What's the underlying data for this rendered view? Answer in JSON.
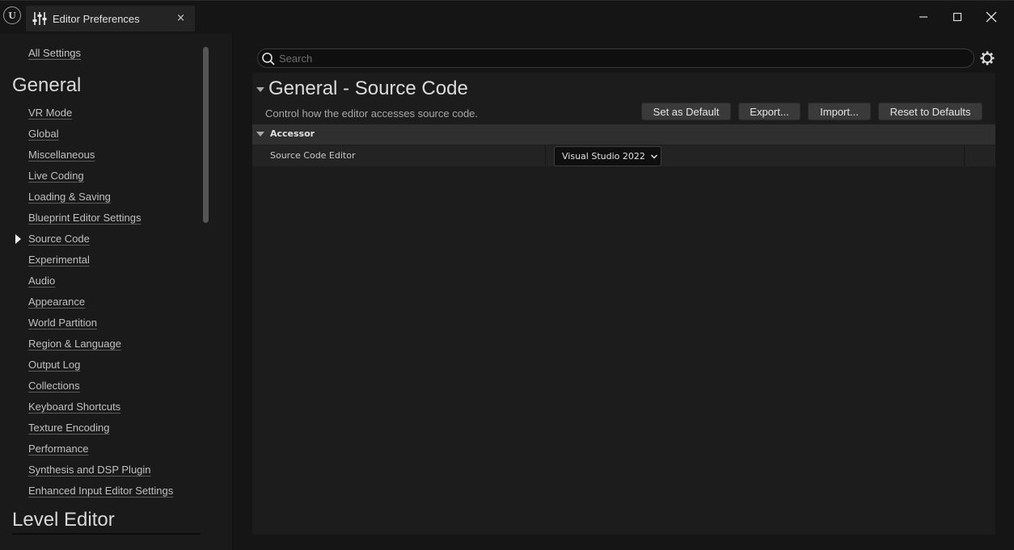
{
  "window": {
    "tab_title": "Editor Preferences",
    "tab_close": "×"
  },
  "sidebar": {
    "all_settings": "All Settings",
    "general_title": "General",
    "items": [
      {
        "label": "VR Mode"
      },
      {
        "label": "Global"
      },
      {
        "label": "Miscellaneous"
      },
      {
        "label": "Live Coding"
      },
      {
        "label": "Loading & Saving"
      },
      {
        "label": "Blueprint Editor Settings"
      },
      {
        "label": "Source Code",
        "selected": true
      },
      {
        "label": "Experimental"
      },
      {
        "label": "Audio"
      },
      {
        "label": "Appearance"
      },
      {
        "label": "World Partition"
      },
      {
        "label": "Region & Language"
      },
      {
        "label": "Output Log"
      },
      {
        "label": "Collections"
      },
      {
        "label": "Keyboard Shortcuts"
      },
      {
        "label": "Texture Encoding"
      },
      {
        "label": "Performance"
      },
      {
        "label": "Synthesis and DSP Plugin"
      },
      {
        "label": "Enhanced Input Editor Settings"
      }
    ],
    "level_editor_title": "Level Editor"
  },
  "search": {
    "placeholder": "Search",
    "value": ""
  },
  "page": {
    "title": "General - Source Code",
    "description": "Control how the editor accesses source code.",
    "buttons": {
      "set_default": "Set as Default",
      "export": "Export...",
      "import": "Import...",
      "reset": "Reset to Defaults"
    }
  },
  "category": {
    "name": "Accessor",
    "properties": [
      {
        "label": "Source Code Editor",
        "value": "Visual Studio 2022"
      }
    ]
  },
  "colors": {
    "background": "#151515",
    "panel": "#1c1c1c",
    "category_header": "#2f2f2f",
    "button": "#3a3a3a"
  },
  "icons": {
    "logo": "unreal-logo-icon",
    "tab": "sliders-icon",
    "search": "search-icon",
    "settings": "gear-icon"
  }
}
